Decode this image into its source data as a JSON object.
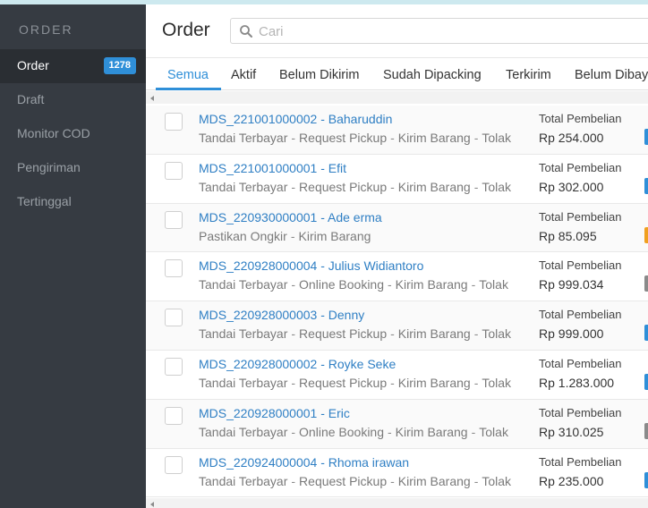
{
  "sidebar": {
    "section_title": "ORDER",
    "items": [
      {
        "label": "Order",
        "badge": "1278",
        "active": true
      },
      {
        "label": "Draft"
      },
      {
        "label": "Monitor COD"
      },
      {
        "label": "Pengiriman"
      },
      {
        "label": "Tertinggal"
      }
    ]
  },
  "header": {
    "title": "Order",
    "search_placeholder": "Cari"
  },
  "tabs": [
    {
      "label": "Semua",
      "active": true
    },
    {
      "label": "Aktif"
    },
    {
      "label": "Belum Dikirim"
    },
    {
      "label": "Sudah Dipacking"
    },
    {
      "label": "Terkirim"
    },
    {
      "label": "Belum Dibay"
    }
  ],
  "orders": [
    {
      "id": "MDS_221001000002 - Baharuddin",
      "actions": [
        "Tandai Terbayar",
        "Request Pickup",
        "Kirim Barang",
        "Tolak"
      ],
      "total_label": "Total Pembelian",
      "total": "Rp 254.000",
      "status_color": "#2f8fd8"
    },
    {
      "id": "MDS_221001000001 - Efit",
      "actions": [
        "Tandai Terbayar",
        "Request Pickup",
        "Kirim Barang",
        "Tolak"
      ],
      "total_label": "Total Pembelian",
      "total": "Rp 302.000",
      "status_color": "#2f8fd8"
    },
    {
      "id": "MDS_220930000001 - Ade erma",
      "actions": [
        "Pastikan Ongkir",
        "Kirim Barang"
      ],
      "total_label": "Total Pembelian",
      "total": "Rp 85.095",
      "status_color": "#f0a020"
    },
    {
      "id": "MDS_220928000004 - Julius Widiantoro",
      "actions": [
        "Tandai Terbayar",
        "Online Booking",
        "Kirim Barang",
        "Tolak"
      ],
      "total_label": "Total Pembelian",
      "total": "Rp 999.034",
      "status_color": "#8a8a8a"
    },
    {
      "id": "MDS_220928000003 - Denny",
      "actions": [
        "Tandai Terbayar",
        "Request Pickup",
        "Kirim Barang",
        "Tolak"
      ],
      "total_label": "Total Pembelian",
      "total": "Rp 999.000",
      "status_color": "#2f8fd8"
    },
    {
      "id": "MDS_220928000002 - Royke Seke",
      "actions": [
        "Tandai Terbayar",
        "Request Pickup",
        "Kirim Barang",
        "Tolak"
      ],
      "total_label": "Total Pembelian",
      "total": "Rp 1.283.000",
      "status_color": "#2f8fd8"
    },
    {
      "id": "MDS_220928000001 - Eric",
      "actions": [
        "Tandai Terbayar",
        "Online Booking",
        "Kirim Barang",
        "Tolak"
      ],
      "total_label": "Total Pembelian",
      "total": "Rp 310.025",
      "status_color": "#8a8a8a"
    },
    {
      "id": "MDS_220924000004 - Rhoma irawan",
      "actions": [
        "Tandai Terbayar",
        "Request Pickup",
        "Kirim Barang",
        "Tolak"
      ],
      "total_label": "Total Pembelian",
      "total": "Rp 235.000",
      "status_color": "#2f8fd8"
    }
  ]
}
